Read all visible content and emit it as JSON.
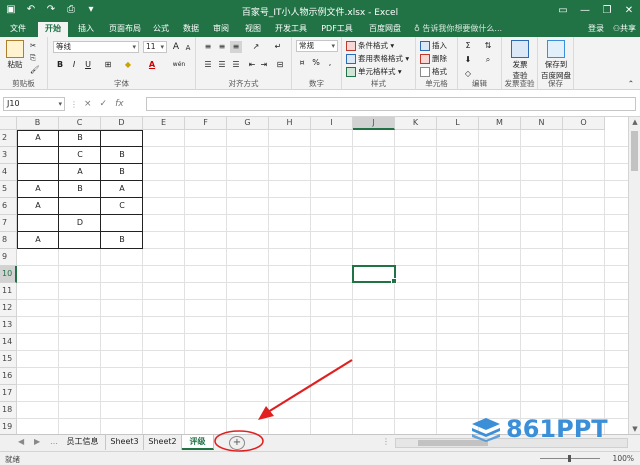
{
  "title": "百家号_IT小人物示例文件.xlsx - Excel",
  "qat": [
    "save-icon",
    "undo-icon",
    "redo-icon",
    "print-preview-icon",
    "customize-icon"
  ],
  "window_controls": [
    "ribbon-options",
    "minimize",
    "restore",
    "close"
  ],
  "tabs": [
    "文件",
    "开始",
    "插入",
    "页面布局",
    "公式",
    "数据",
    "审阅",
    "视图",
    "开发工具",
    "PDF工具集",
    "百度网盘"
  ],
  "active_tab": "开始",
  "tell_me": "告诉我你想要做什么...",
  "login": "登录",
  "share": "共享",
  "ribbon": {
    "clipboard": {
      "paste": "粘贴",
      "label": "剪贴板"
    },
    "font": {
      "name": "等线",
      "size": "11",
      "label": "字体",
      "bold": "B",
      "italic": "I",
      "underline": "U",
      "font_color_char": "A",
      "grow": "A",
      "shrink": "A",
      "wen": "wén"
    },
    "alignment": {
      "label": "对齐方式"
    },
    "number": {
      "format": "常规",
      "percent": "%",
      "label": "数字"
    },
    "styles": {
      "conditional": "条件格式",
      "table": "套用表格格式",
      "cell": "单元格样式",
      "label": "样式"
    },
    "cells": {
      "insert": "插入",
      "delete": "删除",
      "format": "格式",
      "label": "单元格"
    },
    "editing": {
      "label": "编辑"
    },
    "invoice": {
      "btn1": "发票",
      "btn2": "查验",
      "label": "发票查验"
    },
    "save": {
      "btn1": "保存到",
      "btn2": "百度网盘",
      "label": "保存"
    }
  },
  "formula_bar": {
    "name_box": "J10",
    "cancel": "×",
    "enter": "✓",
    "fx": "fx",
    "value": ""
  },
  "columns": [
    "B",
    "C",
    "D",
    "E",
    "F",
    "G",
    "H",
    "I",
    "J",
    "K",
    "L",
    "M",
    "N",
    "O"
  ],
  "selected_column": "J",
  "rows": [
    "2",
    "3",
    "4",
    "5",
    "6",
    "7",
    "8",
    "9",
    "10",
    "11",
    "12",
    "13",
    "14",
    "15",
    "16",
    "17",
    "18",
    "19"
  ],
  "selected_row": "10",
  "cells": {
    "r2": [
      "A",
      "B",
      ""
    ],
    "r3": [
      "",
      "C",
      "B"
    ],
    "r4": [
      "",
      "A",
      "B"
    ],
    "r5": [
      "A",
      "B",
      "A"
    ],
    "r6": [
      "A",
      "",
      "C"
    ],
    "r7": [
      "",
      "D",
      ""
    ],
    "r8": [
      "A",
      "",
      "B"
    ]
  },
  "sheets": [
    "员工信息",
    "Sheet3",
    "Sheet2",
    "评级"
  ],
  "active_sheet": "评级",
  "add_sheet": "+",
  "status": "就绪",
  "zoom": "100%",
  "watermark": "861PPT",
  "colors": {
    "accent": "#217346",
    "annotation": "#e02020",
    "watermark": "#3b8fd8"
  }
}
